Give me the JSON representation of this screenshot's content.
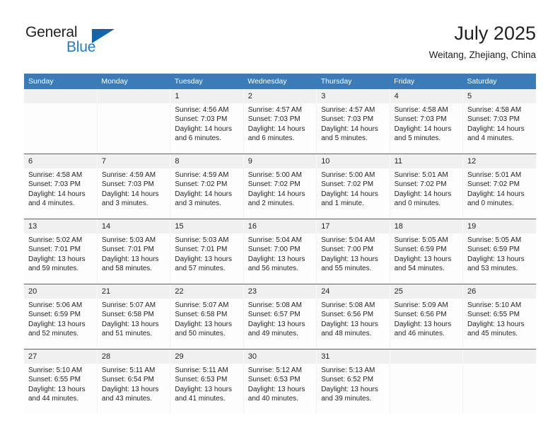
{
  "brand": {
    "name_part1": "General",
    "name_part2": "Blue",
    "triangle_icon": "triangle-icon",
    "color_dark": "#231f20",
    "color_blue": "#1f7ec2"
  },
  "header": {
    "title": "July 2025",
    "subtitle": "Weitang, Zhejiang, China"
  },
  "theme": {
    "header_bar": "#3b7cb8",
    "week_separator": "#2b6ca8",
    "daynum_band": "#f0f0f0",
    "cell_bg": "#fdfdfd"
  },
  "weekday_headers": [
    "Sunday",
    "Monday",
    "Tuesday",
    "Wednesday",
    "Thursday",
    "Friday",
    "Saturday"
  ],
  "weeks": [
    {
      "days": [
        {
          "num": "",
          "sunrise": "",
          "sunset": "",
          "daylight1": "",
          "daylight2": ""
        },
        {
          "num": "",
          "sunrise": "",
          "sunset": "",
          "daylight1": "",
          "daylight2": ""
        },
        {
          "num": "1",
          "sunrise": "Sunrise: 4:56 AM",
          "sunset": "Sunset: 7:03 PM",
          "daylight1": "Daylight: 14 hours",
          "daylight2": "and 6 minutes."
        },
        {
          "num": "2",
          "sunrise": "Sunrise: 4:57 AM",
          "sunset": "Sunset: 7:03 PM",
          "daylight1": "Daylight: 14 hours",
          "daylight2": "and 6 minutes."
        },
        {
          "num": "3",
          "sunrise": "Sunrise: 4:57 AM",
          "sunset": "Sunset: 7:03 PM",
          "daylight1": "Daylight: 14 hours",
          "daylight2": "and 5 minutes."
        },
        {
          "num": "4",
          "sunrise": "Sunrise: 4:58 AM",
          "sunset": "Sunset: 7:03 PM",
          "daylight1": "Daylight: 14 hours",
          "daylight2": "and 5 minutes."
        },
        {
          "num": "5",
          "sunrise": "Sunrise: 4:58 AM",
          "sunset": "Sunset: 7:03 PM",
          "daylight1": "Daylight: 14 hours",
          "daylight2": "and 4 minutes."
        }
      ]
    },
    {
      "days": [
        {
          "num": "6",
          "sunrise": "Sunrise: 4:58 AM",
          "sunset": "Sunset: 7:03 PM",
          "daylight1": "Daylight: 14 hours",
          "daylight2": "and 4 minutes."
        },
        {
          "num": "7",
          "sunrise": "Sunrise: 4:59 AM",
          "sunset": "Sunset: 7:03 PM",
          "daylight1": "Daylight: 14 hours",
          "daylight2": "and 3 minutes."
        },
        {
          "num": "8",
          "sunrise": "Sunrise: 4:59 AM",
          "sunset": "Sunset: 7:02 PM",
          "daylight1": "Daylight: 14 hours",
          "daylight2": "and 3 minutes."
        },
        {
          "num": "9",
          "sunrise": "Sunrise: 5:00 AM",
          "sunset": "Sunset: 7:02 PM",
          "daylight1": "Daylight: 14 hours",
          "daylight2": "and 2 minutes."
        },
        {
          "num": "10",
          "sunrise": "Sunrise: 5:00 AM",
          "sunset": "Sunset: 7:02 PM",
          "daylight1": "Daylight: 14 hours",
          "daylight2": "and 1 minute."
        },
        {
          "num": "11",
          "sunrise": "Sunrise: 5:01 AM",
          "sunset": "Sunset: 7:02 PM",
          "daylight1": "Daylight: 14 hours",
          "daylight2": "and 0 minutes."
        },
        {
          "num": "12",
          "sunrise": "Sunrise: 5:01 AM",
          "sunset": "Sunset: 7:02 PM",
          "daylight1": "Daylight: 14 hours",
          "daylight2": "and 0 minutes."
        }
      ]
    },
    {
      "days": [
        {
          "num": "13",
          "sunrise": "Sunrise: 5:02 AM",
          "sunset": "Sunset: 7:01 PM",
          "daylight1": "Daylight: 13 hours",
          "daylight2": "and 59 minutes."
        },
        {
          "num": "14",
          "sunrise": "Sunrise: 5:03 AM",
          "sunset": "Sunset: 7:01 PM",
          "daylight1": "Daylight: 13 hours",
          "daylight2": "and 58 minutes."
        },
        {
          "num": "15",
          "sunrise": "Sunrise: 5:03 AM",
          "sunset": "Sunset: 7:01 PM",
          "daylight1": "Daylight: 13 hours",
          "daylight2": "and 57 minutes."
        },
        {
          "num": "16",
          "sunrise": "Sunrise: 5:04 AM",
          "sunset": "Sunset: 7:00 PM",
          "daylight1": "Daylight: 13 hours",
          "daylight2": "and 56 minutes."
        },
        {
          "num": "17",
          "sunrise": "Sunrise: 5:04 AM",
          "sunset": "Sunset: 7:00 PM",
          "daylight1": "Daylight: 13 hours",
          "daylight2": "and 55 minutes."
        },
        {
          "num": "18",
          "sunrise": "Sunrise: 5:05 AM",
          "sunset": "Sunset: 6:59 PM",
          "daylight1": "Daylight: 13 hours",
          "daylight2": "and 54 minutes."
        },
        {
          "num": "19",
          "sunrise": "Sunrise: 5:05 AM",
          "sunset": "Sunset: 6:59 PM",
          "daylight1": "Daylight: 13 hours",
          "daylight2": "and 53 minutes."
        }
      ]
    },
    {
      "days": [
        {
          "num": "20",
          "sunrise": "Sunrise: 5:06 AM",
          "sunset": "Sunset: 6:59 PM",
          "daylight1": "Daylight: 13 hours",
          "daylight2": "and 52 minutes."
        },
        {
          "num": "21",
          "sunrise": "Sunrise: 5:07 AM",
          "sunset": "Sunset: 6:58 PM",
          "daylight1": "Daylight: 13 hours",
          "daylight2": "and 51 minutes."
        },
        {
          "num": "22",
          "sunrise": "Sunrise: 5:07 AM",
          "sunset": "Sunset: 6:58 PM",
          "daylight1": "Daylight: 13 hours",
          "daylight2": "and 50 minutes."
        },
        {
          "num": "23",
          "sunrise": "Sunrise: 5:08 AM",
          "sunset": "Sunset: 6:57 PM",
          "daylight1": "Daylight: 13 hours",
          "daylight2": "and 49 minutes."
        },
        {
          "num": "24",
          "sunrise": "Sunrise: 5:08 AM",
          "sunset": "Sunset: 6:56 PM",
          "daylight1": "Daylight: 13 hours",
          "daylight2": "and 48 minutes."
        },
        {
          "num": "25",
          "sunrise": "Sunrise: 5:09 AM",
          "sunset": "Sunset: 6:56 PM",
          "daylight1": "Daylight: 13 hours",
          "daylight2": "and 46 minutes."
        },
        {
          "num": "26",
          "sunrise": "Sunrise: 5:10 AM",
          "sunset": "Sunset: 6:55 PM",
          "daylight1": "Daylight: 13 hours",
          "daylight2": "and 45 minutes."
        }
      ]
    },
    {
      "days": [
        {
          "num": "27",
          "sunrise": "Sunrise: 5:10 AM",
          "sunset": "Sunset: 6:55 PM",
          "daylight1": "Daylight: 13 hours",
          "daylight2": "and 44 minutes."
        },
        {
          "num": "28",
          "sunrise": "Sunrise: 5:11 AM",
          "sunset": "Sunset: 6:54 PM",
          "daylight1": "Daylight: 13 hours",
          "daylight2": "and 43 minutes."
        },
        {
          "num": "29",
          "sunrise": "Sunrise: 5:11 AM",
          "sunset": "Sunset: 6:53 PM",
          "daylight1": "Daylight: 13 hours",
          "daylight2": "and 41 minutes."
        },
        {
          "num": "30",
          "sunrise": "Sunrise: 5:12 AM",
          "sunset": "Sunset: 6:53 PM",
          "daylight1": "Daylight: 13 hours",
          "daylight2": "and 40 minutes."
        },
        {
          "num": "31",
          "sunrise": "Sunrise: 5:13 AM",
          "sunset": "Sunset: 6:52 PM",
          "daylight1": "Daylight: 13 hours",
          "daylight2": "and 39 minutes."
        },
        {
          "num": "",
          "sunrise": "",
          "sunset": "",
          "daylight1": "",
          "daylight2": ""
        },
        {
          "num": "",
          "sunrise": "",
          "sunset": "",
          "daylight1": "",
          "daylight2": ""
        }
      ]
    }
  ]
}
